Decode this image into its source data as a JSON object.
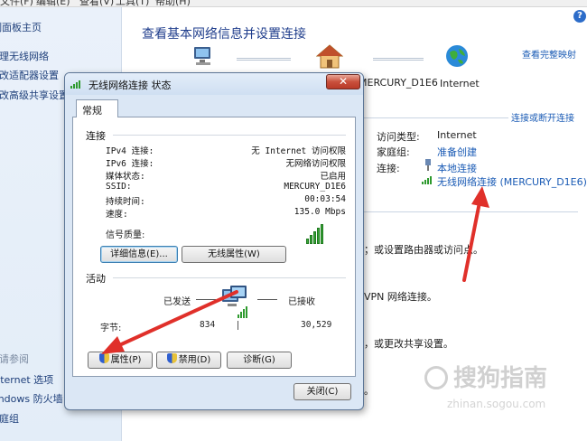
{
  "menubar": {
    "items": [
      "文件(F)",
      "编辑(E)",
      "查看(V)",
      "工具(T)",
      "帮助(H)"
    ]
  },
  "leftpane": {
    "home": "控制面板主页",
    "links": [
      "管理无线网络",
      "更改适配器设置",
      "更改高级共享设置"
    ],
    "see_also": "另请参阅",
    "see_also_links": [
      "Internet 选项",
      "Windows 防火墙",
      "家庭组"
    ]
  },
  "main": {
    "title": "查看基本网络信息并设置连接",
    "view_full_map": "查看完整映射",
    "map_labels": {
      "computer": "",
      "network": "MERCURY_D1E6",
      "internet": "Internet"
    },
    "connect_disconnect": "连接或断开连接",
    "access_type_label": "访问类型:",
    "access_type_value": "Internet",
    "homegroup_label": "家庭组:",
    "homegroup_value": "准备创建",
    "connections_label": "连接:",
    "connection_1": "本地连接",
    "connection_2": "无线网络连接 (MERCURY_D1E6)",
    "text_1": "；或设置路由器或访问点。",
    "text_2": "VPN 网络连接。",
    "text_3": "，或更改共享设置。",
    "text_4": "。"
  },
  "dialog": {
    "title": "无线网络连接 状态",
    "close_glyph": "✕",
    "tab": "常规",
    "connection_group": "连接",
    "rows": [
      {
        "key": "IPv4 连接:",
        "value": "无 Internet 访问权限"
      },
      {
        "key": "IPv6 连接:",
        "value": "无网络访问权限"
      },
      {
        "key": "媒体状态:",
        "value": "已启用"
      },
      {
        "key": "SSID:",
        "value": "MERCURY_D1E6"
      },
      {
        "key": "持续时间:",
        "value": "00:03:54"
      },
      {
        "key": "速度:",
        "value": "135.0 Mbps"
      }
    ],
    "signal_quality_label": "信号质量:",
    "details_button": "详细信息(E)...",
    "wireless_props_button": "无线属性(W)",
    "activity_group": "活动",
    "sent_label": "已发送",
    "received_label": "已接收",
    "bytes_label": "字节:",
    "bytes_sent": "834",
    "bytes_received": "30,529",
    "properties_button": "属性(P)",
    "disable_button": "禁用(D)",
    "diagnose_button": "诊断(G)",
    "close_button": "关闭(C)"
  },
  "watermark": {
    "main": "搜狗指南",
    "sub": "zhinan.sogou.com"
  },
  "colors": {
    "link": "#1a5bb5",
    "title": "#1f3d8c",
    "arrow": "#e0302a",
    "dialog_bg": "#dbe7f5"
  }
}
